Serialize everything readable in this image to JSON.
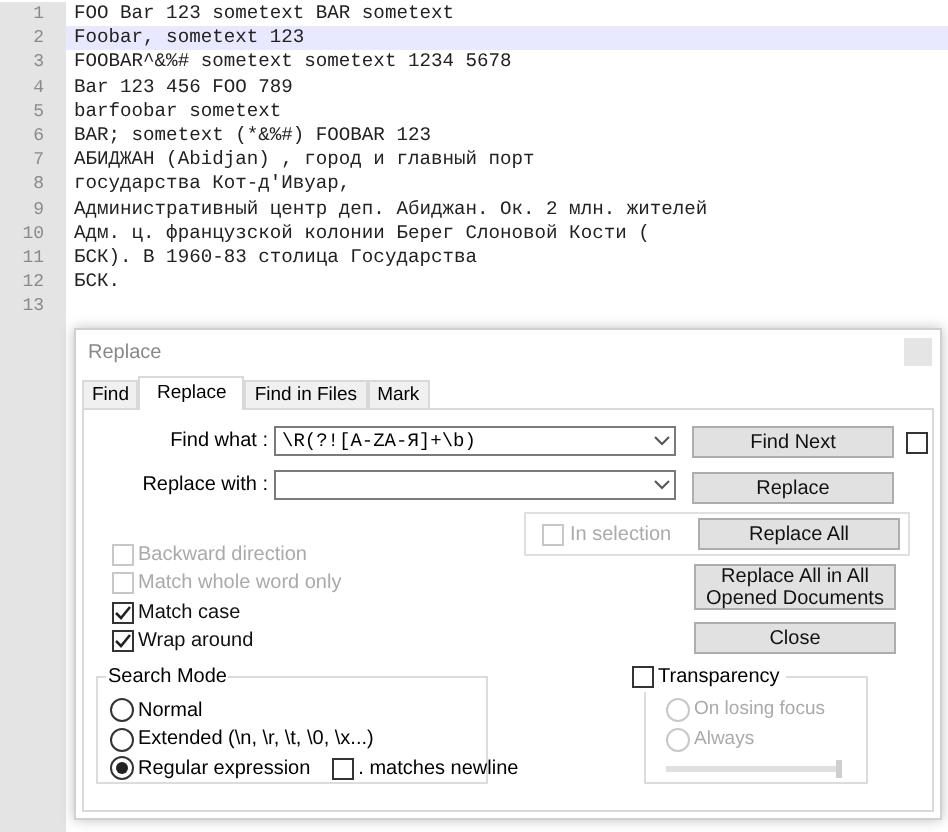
{
  "editor": {
    "lines": [
      {
        "number": "1",
        "text": "FOO Bar 123 sometext BAR sometext",
        "highlighted": false
      },
      {
        "number": "2",
        "text": "Foobar, sometext 123",
        "highlighted": true
      },
      {
        "number": "3",
        "text": "FOOBAR^&%# sometext sometext 1234 5678",
        "highlighted": false
      },
      {
        "number": "4",
        "text": "Bar 123 456 FOO 789",
        "highlighted": false
      },
      {
        "number": "5",
        "text": "barfoobar sometext",
        "highlighted": false
      },
      {
        "number": "6",
        "text": "BAR; sometext (*&%#) FOOBAR 123",
        "highlighted": false
      },
      {
        "number": "7",
        "text": "АБИДЖАН (Abidjan) , город и главный порт",
        "highlighted": false
      },
      {
        "number": "8",
        "text": "государства Кот-д'Ивуар,",
        "highlighted": false
      },
      {
        "number": "9",
        "text": "Административный центр деп. Абиджан. Ок. 2 млн. жителей",
        "highlighted": false
      },
      {
        "number": "10",
        "text": "Адм. ц. французской колонии Берег Слоновой Кости (",
        "highlighted": false
      },
      {
        "number": "11",
        "text": "БСК). В 1960-83 столица Государства",
        "highlighted": false
      },
      {
        "number": "12",
        "text": "БСК.",
        "highlighted": false
      },
      {
        "number": "13",
        "highlighted": false
      }
    ]
  },
  "dialog": {
    "title": "Replace",
    "tabs": [
      {
        "label": "Find",
        "selected": false
      },
      {
        "label": "Replace",
        "selected": true
      },
      {
        "label": "Find in Files",
        "selected": false
      },
      {
        "label": "Mark",
        "selected": false
      }
    ],
    "find_what": {
      "label": "Find what :",
      "value": "\\R(?![A-ZА-Я]+\\b)"
    },
    "replace_with": {
      "label": "Replace with :"
    },
    "find_next_toggle": {
      "checked": false
    },
    "in_selection": {
      "label": "In selection",
      "checked": false,
      "disabled": true
    },
    "buttons": [
      "Find Next",
      "Replace",
      "Replace All",
      "Replace All in All Opened Documents",
      "Close"
    ],
    "options": [
      {
        "label": "Backward direction",
        "checked": false,
        "disabled": true
      },
      {
        "label": "Match whole word only",
        "checked": false,
        "disabled": true
      },
      {
        "label": "Match case",
        "checked": true,
        "disabled": false
      },
      {
        "label": "Wrap around",
        "checked": true,
        "disabled": false
      }
    ],
    "search_mode": {
      "title": "Search Mode",
      "modes": [
        {
          "label": "Normal",
          "selected": false
        },
        {
          "label": "Extended (\\n, \\r, \\t, \\0, \\x...)",
          "selected": false
        },
        {
          "label": "Regular expression",
          "selected": true
        }
      ],
      "matches_newline": {
        "label": ". matches newline",
        "checked": false
      }
    },
    "transparency": {
      "label": "Transparency",
      "checked": false,
      "options": [
        {
          "label": "On losing focus",
          "selected": false,
          "disabled": true
        },
        {
          "label": "Always",
          "selected": false,
          "disabled": true
        }
      ],
      "level": 1
    }
  }
}
